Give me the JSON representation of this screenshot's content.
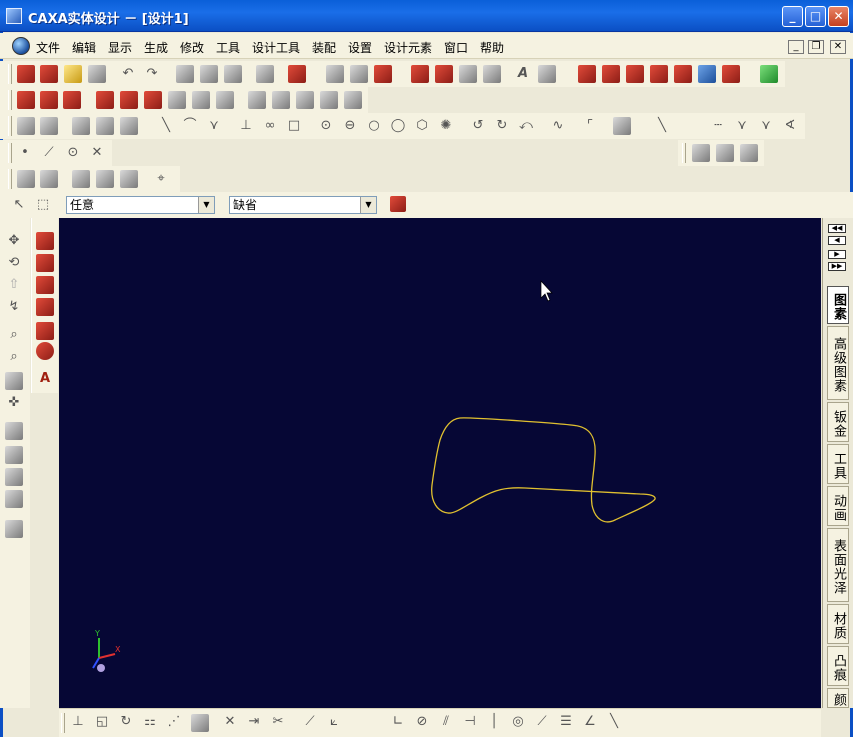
{
  "window": {
    "title": "CAXA实体设计 － [设计1]",
    "minimize": "_",
    "maximize": "□",
    "close": "✕"
  },
  "menu": {
    "items": [
      "文件",
      "编辑",
      "显示",
      "生成",
      "修改",
      "工具",
      "设计工具",
      "装配",
      "设置",
      "设计元素",
      "窗口",
      "帮助"
    ],
    "mdi_min": "_",
    "mdi_restore": "❐",
    "mdi_close": "✕"
  },
  "filter": {
    "selection_filter": "任意",
    "layer": "缺省"
  },
  "right_tabs": [
    "图素",
    "高级图素",
    "钣金",
    "工具",
    "动画",
    "表面光泽",
    "材质",
    "凸痕",
    "颜"
  ],
  "viewport": {
    "background": "#060735",
    "curve_color": "#e0c030",
    "axis_y_label": "Y",
    "axis_x_label": "X"
  }
}
